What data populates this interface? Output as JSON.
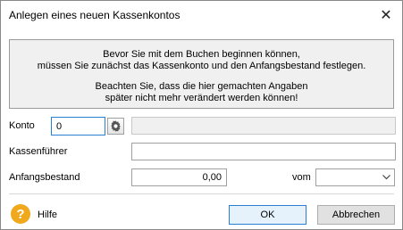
{
  "window": {
    "title": "Anlegen eines neuen Kassenkontos",
    "close_glyph": "✕"
  },
  "info": {
    "line1": "Bevor Sie mit dem Buchen beginnen können,",
    "line2": "müssen Sie zunächst das Kassenkonto und den Anfangsbestand festlegen.",
    "line3": "Beachten Sie, dass die hier gemachten Angaben",
    "line4": "später nicht mehr verändert werden können!"
  },
  "form": {
    "konto_label": "Konto",
    "konto_value": "0",
    "konto_name_value": "",
    "kassenfuehrer_label": "Kassenführer",
    "kassenfuehrer_value": "",
    "anfangsbestand_label": "Anfangsbestand",
    "anfangsbestand_value": "0,00",
    "vom_label": "vom",
    "vom_value": ""
  },
  "footer": {
    "help_glyph": "?",
    "help_label": "Hilfe",
    "ok_label": "OK",
    "cancel_label": "Abbrechen"
  },
  "colors": {
    "accent": "#2a7fd4",
    "help": "#f0a81c"
  },
  "icons": {
    "close": "close-icon",
    "gear": "gear-icon",
    "dropdown": "chevron-down-icon",
    "help": "help-icon"
  }
}
